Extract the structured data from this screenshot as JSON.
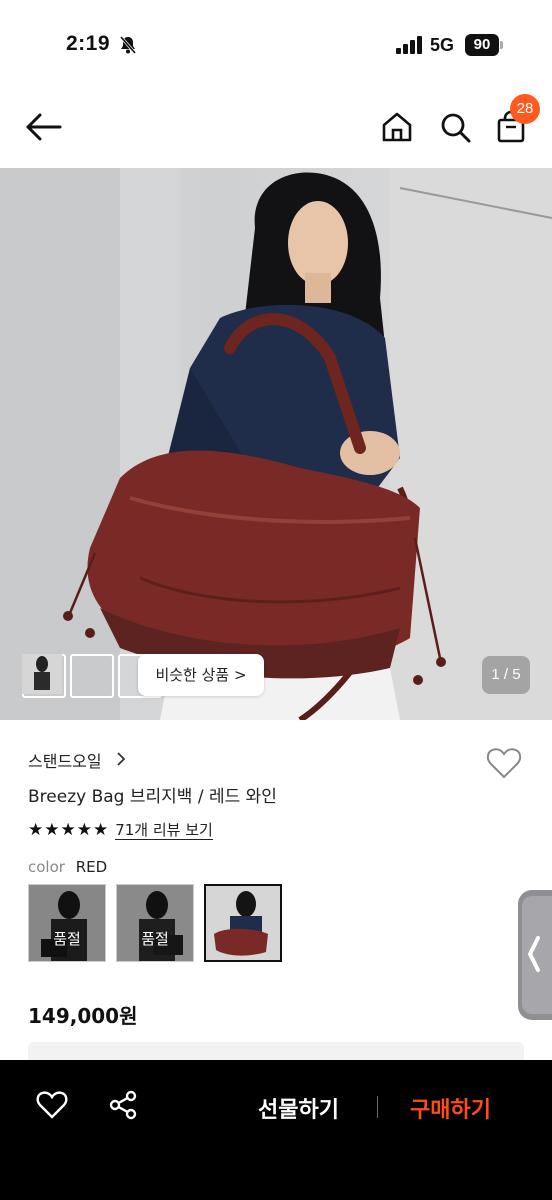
{
  "status_bar": {
    "time": "2:19",
    "network": "5G",
    "battery": "90"
  },
  "header": {
    "cart_count": "28"
  },
  "gallery": {
    "similar_label": "비슷한 상품 >",
    "page_indicator": "1 / 5"
  },
  "product": {
    "brand": "스탠드오일",
    "name": "Breezy Bag 브리지백 / 레드 와인",
    "stars": "★★★★★",
    "review_link": "71개 리뷰 보기",
    "color_key": "color",
    "color_value": "RED",
    "options": [
      {
        "soldout_label": "품절"
      },
      {
        "soldout_label": "품절"
      },
      {
        "soldout_label": ""
      }
    ],
    "price": "149,000원"
  },
  "bottom_bar": {
    "gift_label": "선물하기",
    "buy_label": "구매하기",
    "buy_color": "#ff4a1a"
  },
  "colors": {
    "accent": "#ff5a1f",
    "bag": "#7a2a26"
  }
}
